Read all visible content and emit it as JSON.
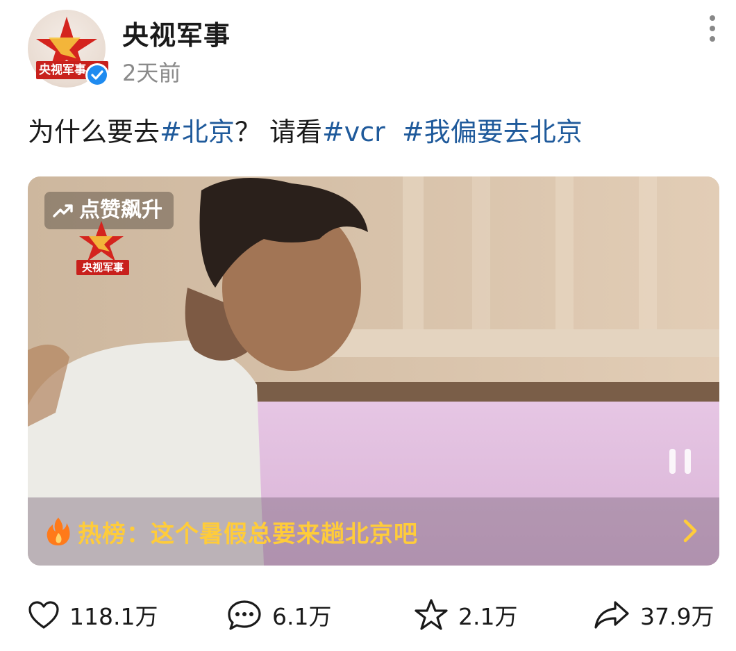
{
  "author": {
    "name": "央视军事",
    "time": "2天前",
    "avatar_text": "央视军事",
    "verified": true,
    "avatar_icon": "star-logo-icon"
  },
  "post": {
    "text_plain_1": "为什么要去",
    "tag_1": "#北京",
    "text_plain_2": "？ 请看",
    "tag_2": "#vcr",
    "tag_3": "#我偏要去北京"
  },
  "video": {
    "trend_badge": "点赞飙升",
    "watermark_text": "央视军事",
    "hot_label": "热榜：这个暑假总要来趟北京吧",
    "state_icon": "pause-icon"
  },
  "actions": {
    "like_count": "118.1万",
    "comment_count": "6.1万",
    "favorite_count": "2.1万",
    "share_count": "37.9万"
  },
  "colors": {
    "hashtag": "#1f5a9b",
    "hot_label": "#ffcc3a",
    "brand_red": "#c8201c"
  }
}
